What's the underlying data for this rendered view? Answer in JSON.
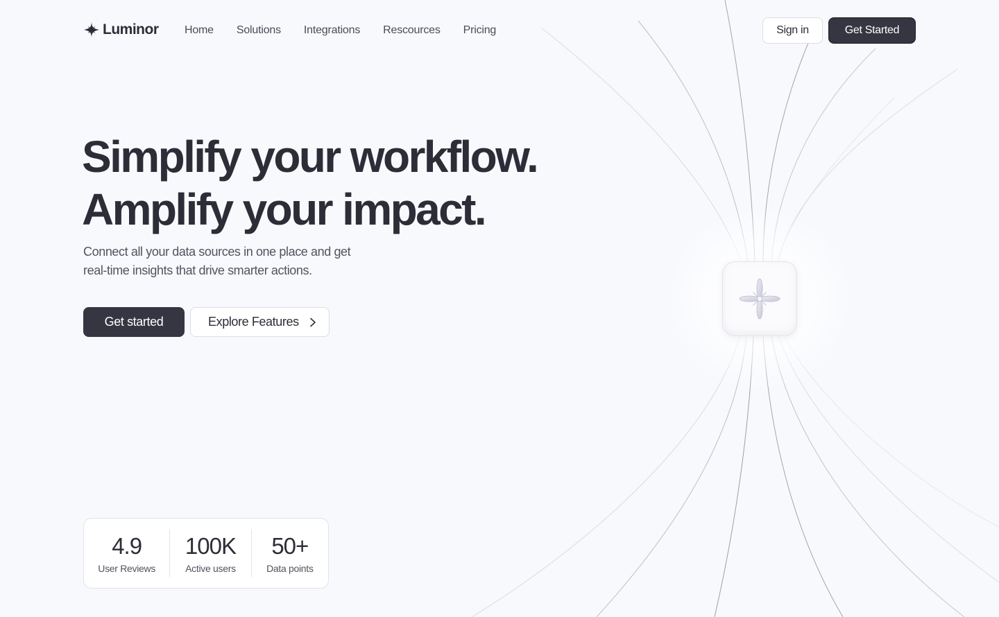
{
  "brand": {
    "name": "Luminor"
  },
  "nav": {
    "links": [
      "Home",
      "Solutions",
      "Integrations",
      "Rescources",
      "Pricing"
    ],
    "signin_label": "Sign in",
    "cta_label": "Get Started"
  },
  "hero": {
    "headline_line1": "Simplify your workflow.",
    "headline_line2": "Amplify your impact.",
    "subtext_line1": "Connect all your data sources in one place and get",
    "subtext_line2": "real-time insights that drive smarter actions.",
    "primary_label": "Get started",
    "secondary_label": "Explore Features"
  },
  "stats": [
    {
      "value": "4.9",
      "label": "User Reviews"
    },
    {
      "value": "100K",
      "label": "Active users"
    },
    {
      "value": "50+",
      "label": "Data points"
    }
  ],
  "colors": {
    "background": "#f8f9fd",
    "primary": "#353641",
    "text": "#2c2d36"
  }
}
